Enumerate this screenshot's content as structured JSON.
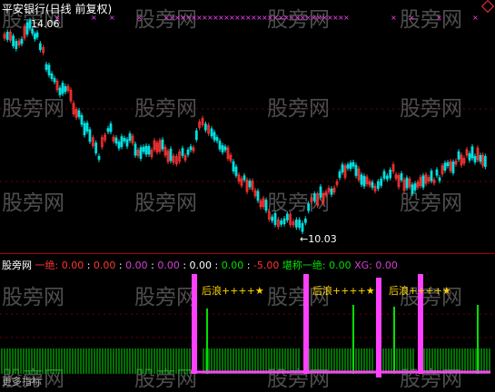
{
  "header": {
    "title": "平安银行(日线 前复权)",
    "high_label": "14.06",
    "low_label": "←10.03"
  },
  "indicator_bar": {
    "name": "股旁网",
    "items": [
      {
        "label": "一绝:",
        "value": "0.00",
        "color": "#ff3333"
      },
      {
        "label": "",
        "value": "0.00",
        "color": "#ff3333"
      },
      {
        "label": "",
        "value": "0.00",
        "color": "#d040d0"
      },
      {
        "label": "",
        "value": "0.00",
        "color": "#d040d0"
      },
      {
        "label": "",
        "value": "0.00",
        "color": "#ffffff"
      },
      {
        "label": "",
        "value": "0.00",
        "color": "#00e000"
      },
      {
        "label": "",
        "value": "-5.00",
        "color": "#ff3333"
      },
      {
        "label": "堪称一绝:",
        "value": "0.00",
        "color": "#00e000"
      },
      {
        "label": "XG:",
        "value": "0.00",
        "color": "#d040d0"
      }
    ]
  },
  "signal_tags": [
    "后浪++++★",
    "后浪++++★",
    "后浪++++★"
  ],
  "watermark": "股旁网",
  "bottom_text": "更多指标",
  "colors": {
    "up": "#ff3333",
    "down": "#00e0e0",
    "green": "#00e000",
    "magenta": "#ff40ff",
    "gold": "#ffd200"
  }
}
